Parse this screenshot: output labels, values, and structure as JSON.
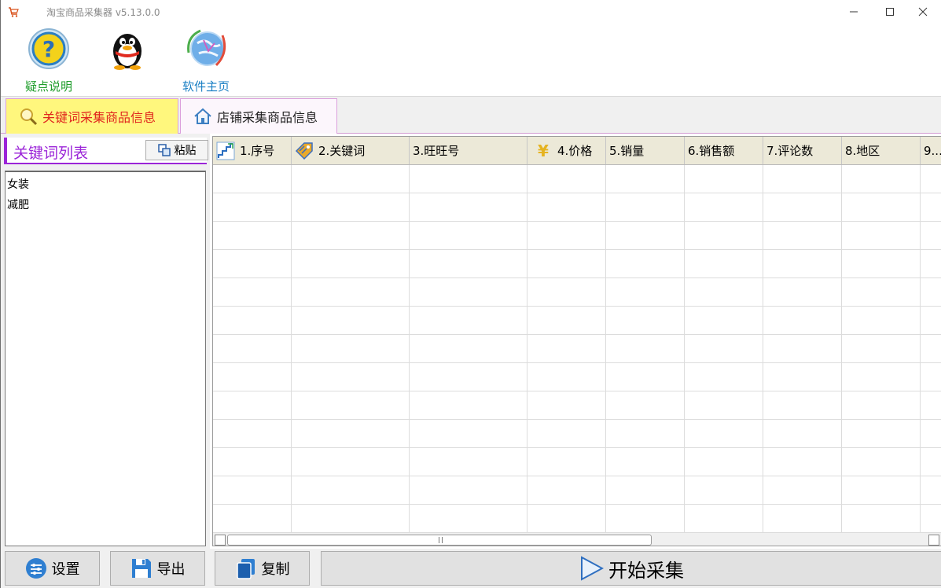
{
  "window": {
    "title": "淘宝商品采集器 v5.13.0.0",
    "controls": {
      "minimize": "—",
      "maximize": "☐",
      "close": "✕"
    }
  },
  "toolbar": {
    "help_label": "疑点说明",
    "qq_label": "",
    "home_label": "软件主页"
  },
  "tabs": [
    {
      "label": "关键词采集商品信息",
      "icon": "search-icon",
      "active": true
    },
    {
      "label": "店铺采集商品信息",
      "icon": "home-icon",
      "active": false
    }
  ],
  "keyword_panel": {
    "title": "关键词列表",
    "paste_label": "粘贴",
    "keywords": [
      "女装",
      "减肥"
    ]
  },
  "grid": {
    "columns": [
      {
        "label": "1.序号",
        "icon": "stairs-icon"
      },
      {
        "label": "2.关键词",
        "icon": "tag-icon"
      },
      {
        "label": "3.旺旺号",
        "icon": ""
      },
      {
        "label": "4.价格",
        "icon": "yen-icon"
      },
      {
        "label": "5.销量",
        "icon": ""
      },
      {
        "label": "6.销售额",
        "icon": ""
      },
      {
        "label": "7.评论数",
        "icon": ""
      },
      {
        "label": "8.地区",
        "icon": ""
      },
      {
        "label": "9...",
        "icon": ""
      }
    ],
    "row_count": 13
  },
  "bottom": {
    "settings_label": "设置",
    "export_label": "导出",
    "copy_label": "复制",
    "start_label": "开始采集"
  },
  "colors": {
    "active_tab_bg": "#fff77d",
    "active_tab_text": "#e0261e",
    "accent_purple": "#9b25d8",
    "header_bg": "#ece9d8"
  }
}
